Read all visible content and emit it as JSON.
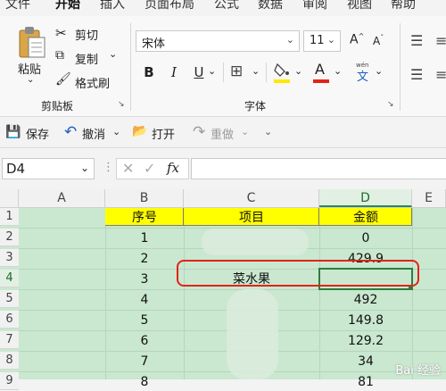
{
  "menu": {
    "items": [
      "文件",
      "开始",
      "插入",
      "页面布局",
      "公式",
      "数据",
      "审阅",
      "视图",
      "帮助"
    ],
    "active_index": 1
  },
  "ribbon": {
    "clipboard": {
      "paste_label": "粘贴",
      "cut_label": "剪切",
      "copy_label": "复制",
      "format_painter_label": "格式刷",
      "group_label": "剪贴板"
    },
    "font": {
      "font_name": "宋体",
      "font_size": "11",
      "bold": "B",
      "italic": "I",
      "underline": "U",
      "increase_size": "A",
      "decrease_size": "A",
      "font_color_letter": "A",
      "group_label": "字体",
      "highlight_color": "#ffe800",
      "font_color": "#e0241b"
    }
  },
  "quickbar": {
    "save_label": "保存",
    "undo_label": "撤消",
    "open_label": "打开",
    "redo_label": "重做"
  },
  "formula_bar": {
    "name_box": "D4",
    "fx_label": "fx",
    "formula_value": ""
  },
  "sheet": {
    "columns": [
      "A",
      "B",
      "C",
      "D",
      "E"
    ],
    "active_column": "D",
    "rows": [
      "1",
      "2",
      "3",
      "4",
      "5",
      "6",
      "7",
      "8",
      "9"
    ],
    "active_row": "4",
    "headers": {
      "b": "序号",
      "c": "项目",
      "d": "金额"
    },
    "data": [
      {
        "b": "1",
        "c": "",
        "d": "0"
      },
      {
        "b": "2",
        "c": "",
        "d": "429.9"
      },
      {
        "b": "3",
        "c": "菜水果",
        "d": ""
      },
      {
        "b": "4",
        "c": "",
        "d": "492"
      },
      {
        "b": "5",
        "c": "",
        "d": "149.8"
      },
      {
        "b": "6",
        "c": "",
        "d": "129.2"
      },
      {
        "b": "7",
        "c": "",
        "d": "34"
      },
      {
        "b": "8",
        "c": "",
        "d": "81"
      }
    ],
    "header_fill": "#ffff00",
    "sheet_bg": "#c9e8cf",
    "annotation_color": "#e0241b"
  },
  "watermark": "Bai 经验"
}
